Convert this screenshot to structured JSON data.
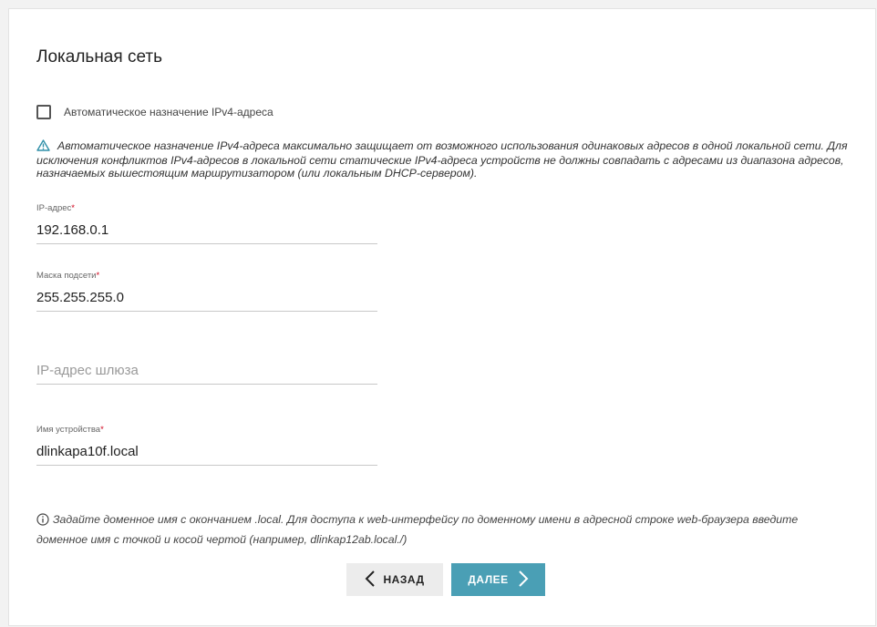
{
  "section": {
    "title": "Локальная сеть"
  },
  "auto_ipv4": {
    "label": "Автоматическое назначение IPv4-адреса",
    "checked": false
  },
  "warning": {
    "icon": "warning-triangle-icon",
    "text": "Автоматическое назначение IPv4-адреса максимально защищает от возможного использования одинаковых адресов в одной локальной сети. Для исключения конфликтов IPv4-адресов в локальной сети статические IPv4-адреса устройств не должны совпадать с адресами из диапазона адресов, назначаемых вышестоящим маршрутизатором (или локальным DHCP-сервером)."
  },
  "fields": {
    "ip": {
      "label": "IP-адрес",
      "required_mark": "*",
      "value": "192.168.0.1",
      "placeholder": ""
    },
    "mask": {
      "label": "Маска подсети",
      "required_mark": "*",
      "value": "255.255.255.0",
      "placeholder": ""
    },
    "gateway": {
      "label": "",
      "value": "",
      "placeholder": "IP-адрес шлюза"
    },
    "device_name": {
      "label": "Имя устройства",
      "required_mark": "*",
      "value": "dlinkapa10f.local",
      "placeholder": ""
    }
  },
  "info": {
    "icon": "info-circle-icon",
    "text": "Задайте доменное имя с окончанием .local. Для доступа к web-интерфейсу по доменному имени в адресной строке web-браузера введите доменное имя с точкой и косой чертой (например, dlinkap12ab.local./)"
  },
  "buttons": {
    "back_label": "НАЗАД",
    "next_label": "ДАЛЕЕ"
  },
  "colors": {
    "accent": "#4a9fb5",
    "warning_icon": "#2f8fa8",
    "required": "#d0021b"
  }
}
